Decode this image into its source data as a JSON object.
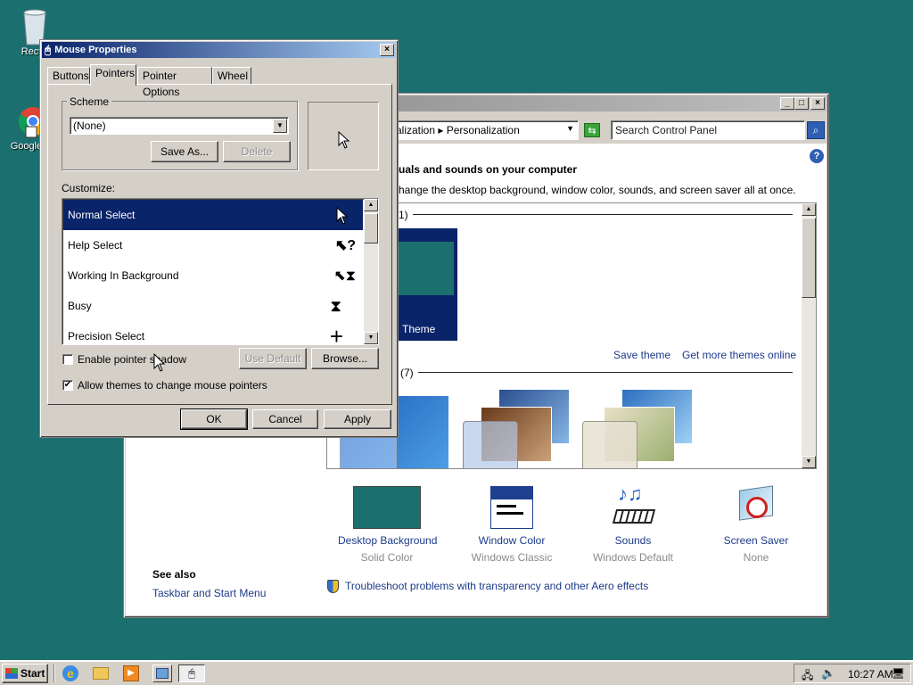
{
  "desktop": {
    "recycle_label": "Recyc",
    "chrome_label": "Google C"
  },
  "control_panel": {
    "breadcrumb_parent": "alization",
    "breadcrumb_current": "Personalization",
    "search_placeholder": "Search Control Panel",
    "heading": "uals and sounds on your computer",
    "subheading": "hange the desktop background, window color, sounds, and screen saver all at once.",
    "my_themes_fragment": "1)",
    "theme_label": "Theme",
    "save_theme": "Save theme",
    "more_themes": "Get more themes online",
    "aero_fragment": "(7)",
    "items": [
      {
        "label": "Desktop Background",
        "sub": "Solid Color",
        "icon": "desktop-background-icon"
      },
      {
        "label": "Window Color",
        "sub": "Windows Classic",
        "icon": "window-color-icon"
      },
      {
        "label": "Sounds",
        "sub": "Windows Default",
        "icon": "sounds-icon"
      },
      {
        "label": "Screen Saver",
        "sub": "None",
        "icon": "screen-saver-icon"
      }
    ],
    "see_also": "See also",
    "taskbar_link": "Taskbar and Start Menu",
    "troubleshoot": "Troubleshoot problems with transparency and other Aero effects",
    "accent": "#1b6f6f"
  },
  "dialog": {
    "title": "Mouse Properties",
    "tabs": [
      "Buttons",
      "Pointers",
      "Pointer Options",
      "Wheel"
    ],
    "active_tab": "Pointers",
    "scheme_label": "Scheme",
    "scheme_value": "(None)",
    "save_as": "Save As...",
    "delete": "Delete",
    "customize_label": "Customize:",
    "pointers": [
      {
        "name": "Normal Select",
        "glyph": "🡤"
      },
      {
        "name": "Help Select",
        "glyph": "?"
      },
      {
        "name": "Working In Background",
        "glyph": "⧗"
      },
      {
        "name": "Busy",
        "glyph": "⧗"
      },
      {
        "name": "Precision Select",
        "glyph": "+"
      }
    ],
    "enable_shadow": "Enable pointer shadow",
    "use_default": "Use Default",
    "browse": "Browse...",
    "allow_themes": "Allow themes to change mouse pointers",
    "ok": "OK",
    "cancel": "Cancel",
    "apply": "Apply"
  },
  "taskbar": {
    "start": "Start",
    "clock": "10:27 AM"
  }
}
